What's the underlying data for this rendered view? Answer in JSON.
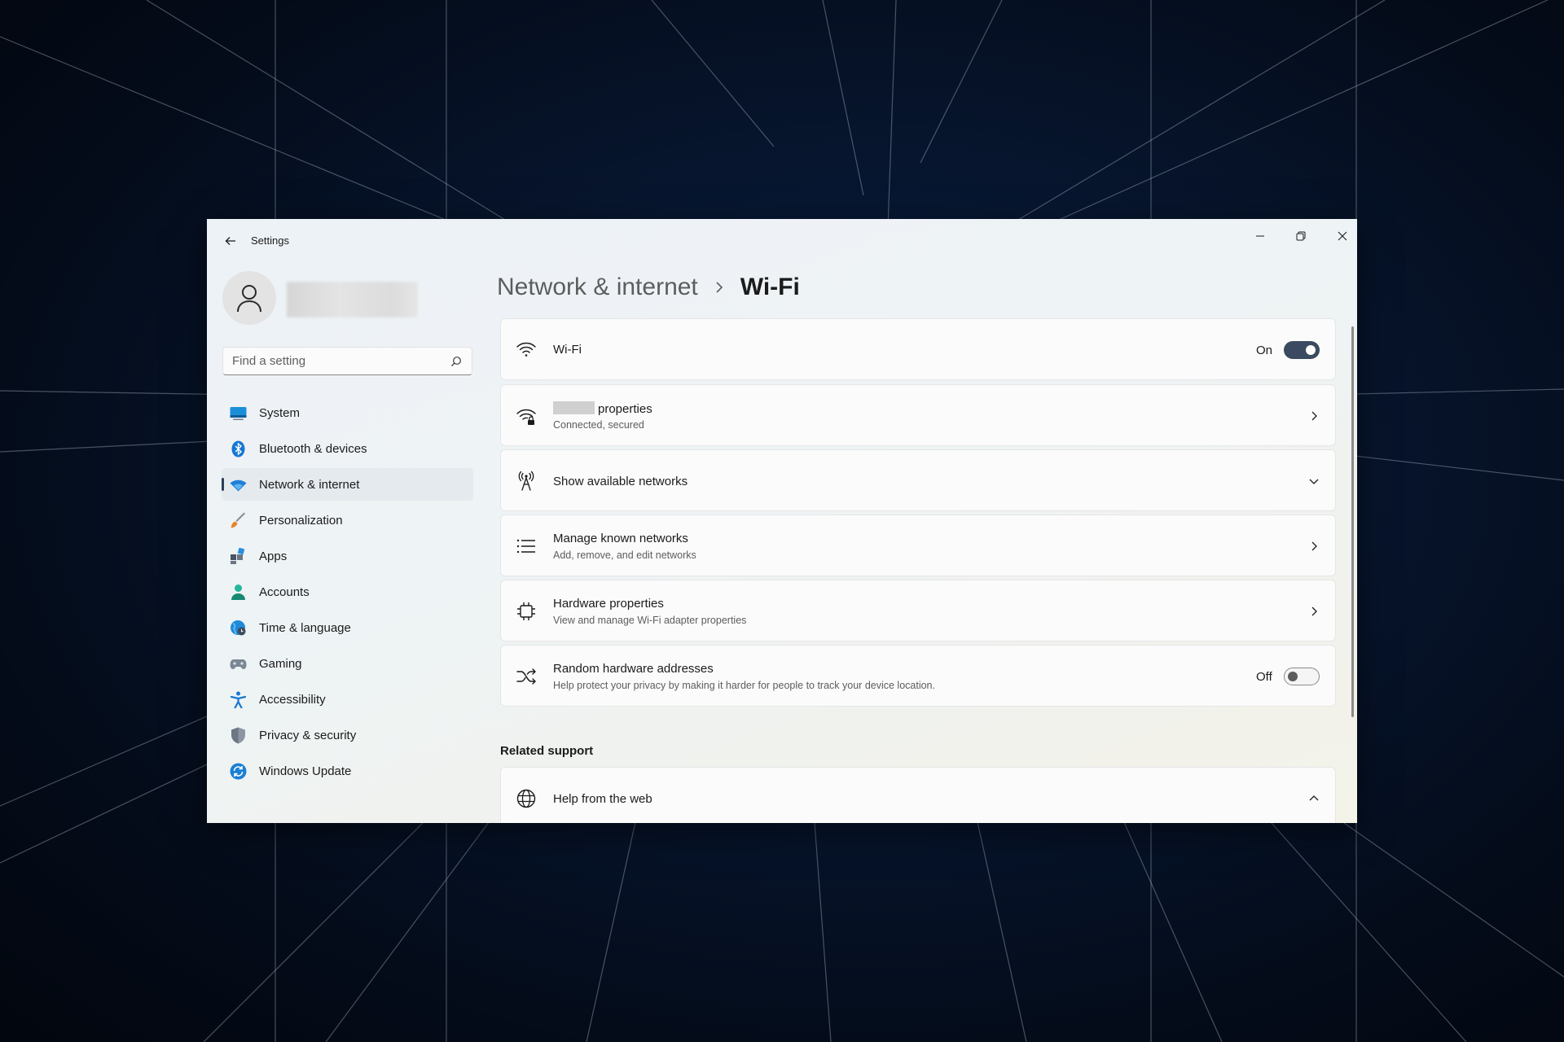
{
  "window": {
    "app_title": "Settings",
    "user_name": ""
  },
  "search": {
    "placeholder": "Find a setting"
  },
  "sidebar": {
    "items": [
      {
        "label": "System",
        "icon": "monitor-icon",
        "selected": false
      },
      {
        "label": "Bluetooth & devices",
        "icon": "bluetooth-icon",
        "selected": false
      },
      {
        "label": "Network & internet",
        "icon": "wifi-icon",
        "selected": true
      },
      {
        "label": "Personalization",
        "icon": "brush-icon",
        "selected": false
      },
      {
        "label": "Apps",
        "icon": "apps-icon",
        "selected": false
      },
      {
        "label": "Accounts",
        "icon": "person-icon",
        "selected": false
      },
      {
        "label": "Time & language",
        "icon": "globe-clock-icon",
        "selected": false
      },
      {
        "label": "Gaming",
        "icon": "gamepad-icon",
        "selected": false
      },
      {
        "label": "Accessibility",
        "icon": "accessibility-icon",
        "selected": false
      },
      {
        "label": "Privacy & security",
        "icon": "shield-icon",
        "selected": false
      },
      {
        "label": "Windows Update",
        "icon": "update-icon",
        "selected": false
      }
    ]
  },
  "breadcrumb": {
    "parent": "Network & internet",
    "current": "Wi-Fi"
  },
  "cards": {
    "wifi": {
      "title": "Wi-Fi",
      "state": "On",
      "toggle_on": true
    },
    "properties": {
      "ssid": "",
      "title": "properties",
      "subtitle": "Connected, secured"
    },
    "available": {
      "title": "Show available networks"
    },
    "known": {
      "title": "Manage known networks",
      "subtitle": "Add, remove, and edit networks"
    },
    "hardware": {
      "title": "Hardware properties",
      "subtitle": "View and manage Wi-Fi adapter properties"
    },
    "random": {
      "title": "Random hardware addresses",
      "subtitle": "Help protect your privacy by making it harder for people to track your device location.",
      "state": "Off",
      "toggle_on": false
    }
  },
  "related": {
    "section_title": "Related support",
    "help_title": "Help from the web"
  },
  "colors": {
    "accent": "#3a4a60",
    "selected_bg": "#e5eaee",
    "card_bg": "#fbfbfb",
    "desktop_bg": "#071630"
  }
}
